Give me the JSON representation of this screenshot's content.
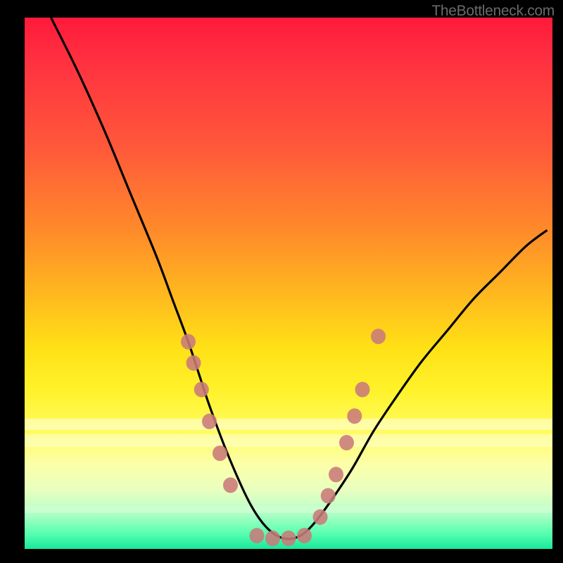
{
  "watermark": "TheBottleneck.com",
  "colors": {
    "background": "#000000",
    "gradient_top": "#ff1a3a",
    "gradient_mid": "#ffe016",
    "gradient_bottom": "#18e89a",
    "curve": "#000000",
    "marker": "#c97a7a"
  },
  "chart_data": {
    "type": "line",
    "title": "",
    "xlabel": "",
    "ylabel": "",
    "xlim": [
      0,
      100
    ],
    "ylim": [
      0,
      100
    ],
    "legend": false,
    "grid": false,
    "series": [
      {
        "name": "bottleneck-curve",
        "x": [
          5,
          10,
          15,
          20,
          25,
          28,
          31,
          33,
          35,
          38,
          41,
          43,
          45,
          47,
          49,
          51,
          53,
          55,
          58,
          62,
          66,
          70,
          75,
          80,
          85,
          90,
          95,
          99
        ],
        "y": [
          100,
          90,
          79,
          67,
          55,
          47,
          39,
          33,
          27,
          19,
          12,
          8,
          5,
          3,
          2,
          2,
          3,
          5,
          9,
          15,
          22,
          28,
          35,
          41,
          47,
          52,
          57,
          60
        ]
      }
    ],
    "markers": {
      "name": "highlight-points",
      "points": [
        {
          "x": 31,
          "y": 39
        },
        {
          "x": 32,
          "y": 35
        },
        {
          "x": 33.5,
          "y": 30
        },
        {
          "x": 35,
          "y": 24
        },
        {
          "x": 37,
          "y": 18
        },
        {
          "x": 39,
          "y": 12
        },
        {
          "x": 44,
          "y": 2.5
        },
        {
          "x": 47,
          "y": 2
        },
        {
          "x": 50,
          "y": 2
        },
        {
          "x": 53,
          "y": 2.5
        },
        {
          "x": 56,
          "y": 6
        },
        {
          "x": 57.5,
          "y": 10
        },
        {
          "x": 59,
          "y": 14
        },
        {
          "x": 61,
          "y": 20
        },
        {
          "x": 62.5,
          "y": 25
        },
        {
          "x": 64,
          "y": 30
        },
        {
          "x": 67,
          "y": 40
        }
      ],
      "radius_percent": 1.4
    }
  }
}
